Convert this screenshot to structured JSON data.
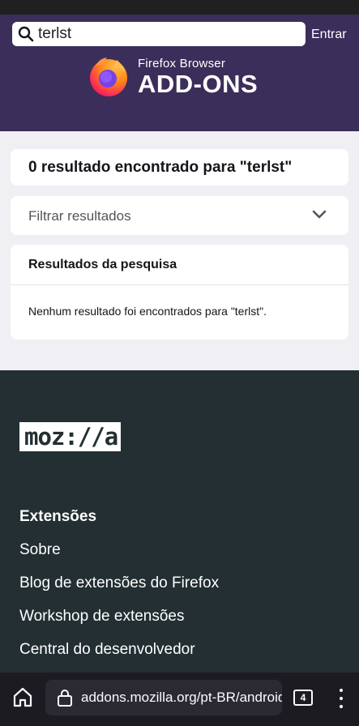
{
  "header": {
    "search_value": "terlst",
    "login_label": "Entrar",
    "brand_small": "Firefox Browser",
    "brand_big": "ADD-ONS"
  },
  "main": {
    "results_count": "0 resultado encontrado para \"terlst\"",
    "filter_label": "Filtrar resultados",
    "results_heading": "Resultados da pesquisa",
    "results_message": "Nenhum resultado foi encontrados para \"terlst\"."
  },
  "footer": {
    "logo_text": "moz://a",
    "section_heading": "Extensões",
    "links": [
      "Sobre",
      "Blog de extensões do Firefox",
      "Workshop de extensões",
      "Central do desenvolvedor"
    ]
  },
  "browser": {
    "url": "addons.mozilla.org/pt-BR/android/",
    "tab_count": "4"
  },
  "colors": {
    "header_bg": "#3b2e5a",
    "page_bg": "#f0f0f4",
    "footer_bg": "#232f32",
    "toolbar_bg": "#1c1b22"
  },
  "icons": [
    "search-icon",
    "chevron-down-icon",
    "firefox-logo",
    "home-icon",
    "lock-icon",
    "tabs-icon",
    "menu-icon"
  ]
}
